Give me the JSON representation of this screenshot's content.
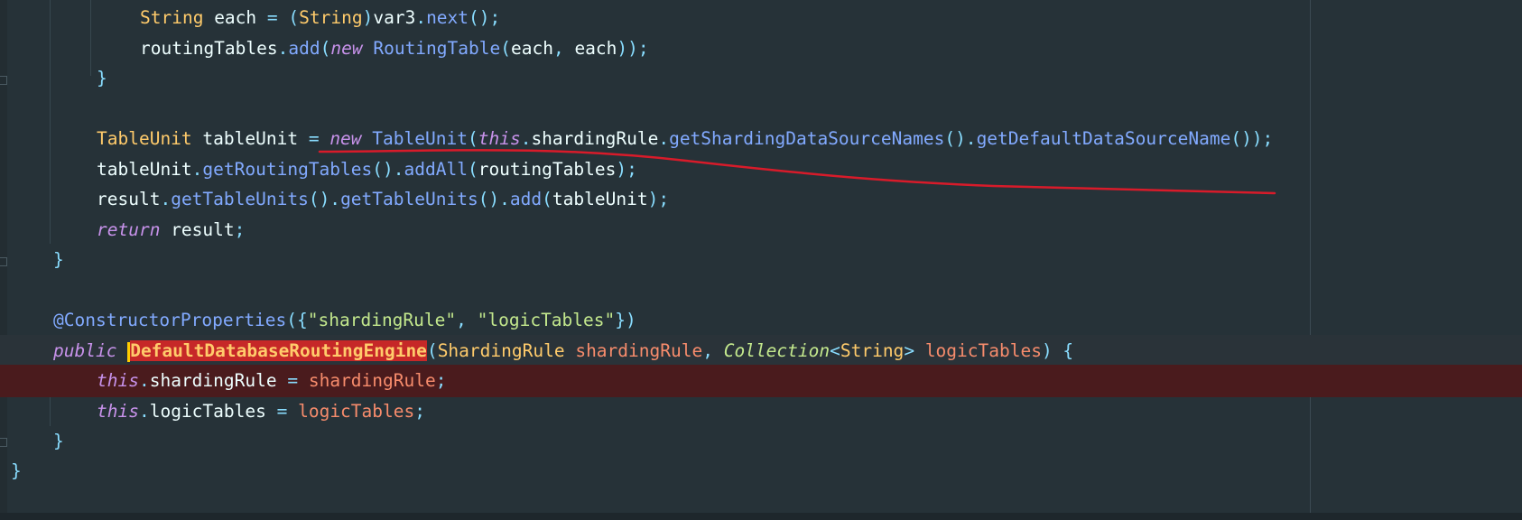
{
  "editor": {
    "lines": [
      {
        "tokens": [
          {
            "t": "String",
            "c": "type"
          },
          {
            "t": " each ",
            "c": "plain"
          },
          {
            "t": "=",
            "c": "punc"
          },
          {
            "t": " (",
            "c": "punc"
          },
          {
            "t": "String",
            "c": "type"
          },
          {
            "t": ")",
            "c": "punc"
          },
          {
            "t": "var3",
            "c": "plain"
          },
          {
            "t": ".",
            "c": "punc"
          },
          {
            "t": "next",
            "c": "method"
          },
          {
            "t": "();",
            "c": "punc"
          }
        ]
      },
      {
        "tokens": [
          {
            "t": "routingTables",
            "c": "plain"
          },
          {
            "t": ".",
            "c": "punc"
          },
          {
            "t": "add",
            "c": "method"
          },
          {
            "t": "(",
            "c": "punc"
          },
          {
            "t": "new",
            "c": "kw"
          },
          {
            "t": " ",
            "c": "plain"
          },
          {
            "t": "RoutingTable",
            "c": "method"
          },
          {
            "t": "(",
            "c": "punc"
          },
          {
            "t": "each",
            "c": "plain"
          },
          {
            "t": ", ",
            "c": "punc"
          },
          {
            "t": "each",
            "c": "plain"
          },
          {
            "t": "));",
            "c": "punc"
          }
        ]
      },
      {
        "tokens": [
          {
            "t": "}",
            "c": "punc"
          }
        ]
      },
      {
        "tokens": []
      },
      {
        "tokens": [
          {
            "t": "TableUnit",
            "c": "type"
          },
          {
            "t": " tableUnit ",
            "c": "plain"
          },
          {
            "t": "=",
            "c": "punc"
          },
          {
            "t": " ",
            "c": "plain"
          },
          {
            "t": "new",
            "c": "kw"
          },
          {
            "t": " ",
            "c": "plain"
          },
          {
            "t": "TableUnit",
            "c": "method"
          },
          {
            "t": "(",
            "c": "punc"
          },
          {
            "t": "this",
            "c": "kw"
          },
          {
            "t": ".",
            "c": "punc"
          },
          {
            "t": "shardingRule",
            "c": "plain"
          },
          {
            "t": ".",
            "c": "punc"
          },
          {
            "t": "getShardingDataSourceNames",
            "c": "method"
          },
          {
            "t": "().",
            "c": "punc"
          },
          {
            "t": "getDefaultDataSourceName",
            "c": "method"
          },
          {
            "t": "());",
            "c": "punc"
          }
        ]
      },
      {
        "tokens": [
          {
            "t": "tableUnit",
            "c": "plain"
          },
          {
            "t": ".",
            "c": "punc"
          },
          {
            "t": "getRoutingTables",
            "c": "method"
          },
          {
            "t": "().",
            "c": "punc"
          },
          {
            "t": "addAll",
            "c": "method"
          },
          {
            "t": "(",
            "c": "punc"
          },
          {
            "t": "routingTables",
            "c": "plain"
          },
          {
            "t": ");",
            "c": "punc"
          }
        ]
      },
      {
        "tokens": [
          {
            "t": "result",
            "c": "plain"
          },
          {
            "t": ".",
            "c": "punc"
          },
          {
            "t": "getTableUnits",
            "c": "method"
          },
          {
            "t": "().",
            "c": "punc"
          },
          {
            "t": "getTableUnits",
            "c": "method"
          },
          {
            "t": "().",
            "c": "punc"
          },
          {
            "t": "add",
            "c": "method"
          },
          {
            "t": "(",
            "c": "punc"
          },
          {
            "t": "tableUnit",
            "c": "plain"
          },
          {
            "t": ");",
            "c": "punc"
          }
        ]
      },
      {
        "tokens": [
          {
            "t": "return",
            "c": "kw"
          },
          {
            "t": " result",
            "c": "plain"
          },
          {
            "t": ";",
            "c": "punc"
          }
        ]
      },
      {
        "tokens": [
          {
            "t": "}",
            "c": "punc"
          }
        ]
      },
      {
        "tokens": []
      },
      {
        "tokens": [
          {
            "t": "@ConstructorProperties",
            "c": "ann"
          },
          {
            "t": "({",
            "c": "punc"
          },
          {
            "t": "\"shardingRule\"",
            "c": "string"
          },
          {
            "t": ", ",
            "c": "punc"
          },
          {
            "t": "\"logicTables\"",
            "c": "string"
          },
          {
            "t": "})",
            "c": "punc"
          }
        ]
      },
      {
        "tokens": [
          {
            "t": "public",
            "c": "kw"
          },
          {
            "t": " ",
            "c": "plain"
          },
          {
            "t": "|",
            "c": "caret"
          },
          {
            "t": "DefaultDatabaseRoutingEngine",
            "c": "sel"
          },
          {
            "t": "(",
            "c": "punc"
          },
          {
            "t": "ShardingRule",
            "c": "type"
          },
          {
            "t": " ",
            "c": "plain"
          },
          {
            "t": "shardingRule",
            "c": "param"
          },
          {
            "t": ", ",
            "c": "punc"
          },
          {
            "t": "Collection",
            "c": "iface"
          },
          {
            "t": "<",
            "c": "punc"
          },
          {
            "t": "String",
            "c": "type"
          },
          {
            "t": ">",
            "c": "punc"
          },
          {
            "t": " ",
            "c": "plain"
          },
          {
            "t": "logicTables",
            "c": "param"
          },
          {
            "t": ") {",
            "c": "punc"
          }
        ]
      },
      {
        "tokens": [
          {
            "t": "this",
            "c": "kw"
          },
          {
            "t": ".",
            "c": "punc"
          },
          {
            "t": "shardingRule",
            "c": "plain"
          },
          {
            "t": " = ",
            "c": "punc"
          },
          {
            "t": "shardingRule",
            "c": "param"
          },
          {
            "t": ";",
            "c": "punc"
          }
        ]
      },
      {
        "tokens": [
          {
            "t": "this",
            "c": "kw"
          },
          {
            "t": ".",
            "c": "punc"
          },
          {
            "t": "logicTables",
            "c": "plain"
          },
          {
            "t": " = ",
            "c": "punc"
          },
          {
            "t": "logicTables",
            "c": "param"
          },
          {
            "t": ";",
            "c": "punc"
          }
        ]
      },
      {
        "tokens": [
          {
            "t": "}",
            "c": "punc"
          }
        ]
      },
      {
        "tokens": [
          {
            "t": "}",
            "c": "punc"
          }
        ]
      }
    ]
  },
  "colors": {
    "background": "#263238",
    "breakpoint_line": "#4a1b1d",
    "selection": "#c62828",
    "annotation_stroke": "#d81b2a"
  }
}
